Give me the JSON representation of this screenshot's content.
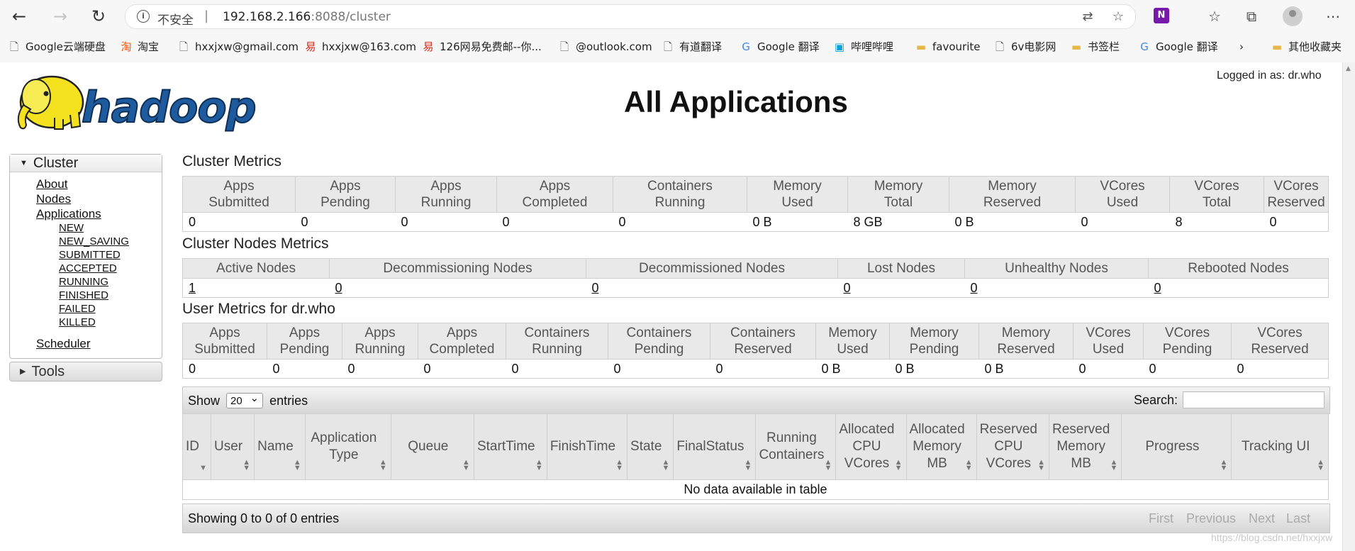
{
  "browser": {
    "address": {
      "insecure_label": "不安全",
      "separator": "|",
      "host": "192.168.2.166",
      "port_path": ":8088/cluster"
    },
    "bookmarks": [
      {
        "label": "Google云端硬盘",
        "icon": "page-icon"
      },
      {
        "label": "淘宝",
        "icon": "taobao-icon"
      },
      {
        "label": "hxxjxw@gmail.com",
        "icon": "page-icon"
      },
      {
        "label": "hxxjxw@163.com",
        "icon": "netease-icon"
      },
      {
        "label": "126网易免费邮--你...",
        "icon": "netease-icon"
      },
      {
        "label": "@outlook.com",
        "icon": "page-icon"
      },
      {
        "label": "有道翻译",
        "icon": "page-icon"
      },
      {
        "label": "Google 翻译",
        "icon": "google-translate-icon"
      },
      {
        "label": "哔哩哔哩",
        "icon": "bilibili-icon"
      },
      {
        "label": "favourite",
        "icon": "folder-icon"
      },
      {
        "label": "6v电影网",
        "icon": "page-icon"
      },
      {
        "label": "书签栏",
        "icon": "folder-icon"
      },
      {
        "label": "Google 翻译",
        "icon": "google-translate-icon"
      },
      {
        "label": "其他收藏夹",
        "icon": "folder-icon"
      }
    ]
  },
  "header": {
    "logged_in": "Logged in as: dr.who",
    "title": "All Applications",
    "logo_text": "hadoop"
  },
  "sidebar": {
    "cluster_label": "Cluster",
    "links": [
      "About",
      "Nodes",
      "Applications"
    ],
    "app_states": [
      "NEW",
      "NEW_SAVING",
      "SUBMITTED",
      "ACCEPTED",
      "RUNNING",
      "FINISHED",
      "FAILED",
      "KILLED"
    ],
    "scheduler": "Scheduler",
    "tools_label": "Tools"
  },
  "cluster_metrics": {
    "title": "Cluster Metrics",
    "headers": [
      [
        "Apps",
        "Submitted"
      ],
      [
        "Apps",
        "Pending"
      ],
      [
        "Apps",
        "Running"
      ],
      [
        "Apps",
        "Completed"
      ],
      [
        "Containers",
        "Running"
      ],
      [
        "Memory",
        "Used"
      ],
      [
        "Memory",
        "Total"
      ],
      [
        "Memory",
        "Reserved"
      ],
      [
        "VCores",
        "Used"
      ],
      [
        "VCores",
        "Total"
      ],
      [
        "VCores",
        "Reserved"
      ]
    ],
    "values": [
      "0",
      "0",
      "0",
      "0",
      "0",
      "0 B",
      "8 GB",
      "0 B",
      "0",
      "8",
      "0"
    ]
  },
  "node_metrics": {
    "title": "Cluster Nodes Metrics",
    "headers": [
      "Active Nodes",
      "Decommissioning Nodes",
      "Decommissioned Nodes",
      "Lost Nodes",
      "Unhealthy Nodes",
      "Rebooted Nodes"
    ],
    "values": [
      "1",
      "0",
      "0",
      "0",
      "0",
      "0"
    ]
  },
  "user_metrics": {
    "title": "User Metrics for dr.who",
    "headers": [
      [
        "Apps",
        "Submitted"
      ],
      [
        "Apps",
        "Pending"
      ],
      [
        "Apps",
        "Running"
      ],
      [
        "Apps",
        "Completed"
      ],
      [
        "Containers",
        "Running"
      ],
      [
        "Containers",
        "Pending"
      ],
      [
        "Containers",
        "Reserved"
      ],
      [
        "Memory",
        "Used"
      ],
      [
        "Memory",
        "Pending"
      ],
      [
        "Memory",
        "Reserved"
      ],
      [
        "VCores",
        "Used"
      ],
      [
        "VCores",
        "Pending"
      ],
      [
        "VCores",
        "Reserved"
      ]
    ],
    "values": [
      "0",
      "0",
      "0",
      "0",
      "0",
      "0",
      "0",
      "0 B",
      "0 B",
      "0 B",
      "0",
      "0",
      "0"
    ]
  },
  "apps_table": {
    "show_label": "Show",
    "page_size": "20",
    "entries_label": "entries",
    "search_label": "Search:",
    "columns": [
      "ID",
      "User",
      "Name",
      "Application Type",
      "Queue",
      "StartTime",
      "FinishTime",
      "State",
      "FinalStatus",
      "Running Containers",
      "Allocated CPU VCores",
      "Allocated Memory MB",
      "Reserved CPU VCores",
      "Reserved Memory MB",
      "Progress",
      "Tracking UI"
    ],
    "empty_message": "No data available in table",
    "info": "Showing 0 to 0 of 0 entries",
    "pager": [
      "First",
      "Previous",
      "Next",
      "Last"
    ]
  },
  "watermark": "https://blog.csdn.net/hxxjxw"
}
